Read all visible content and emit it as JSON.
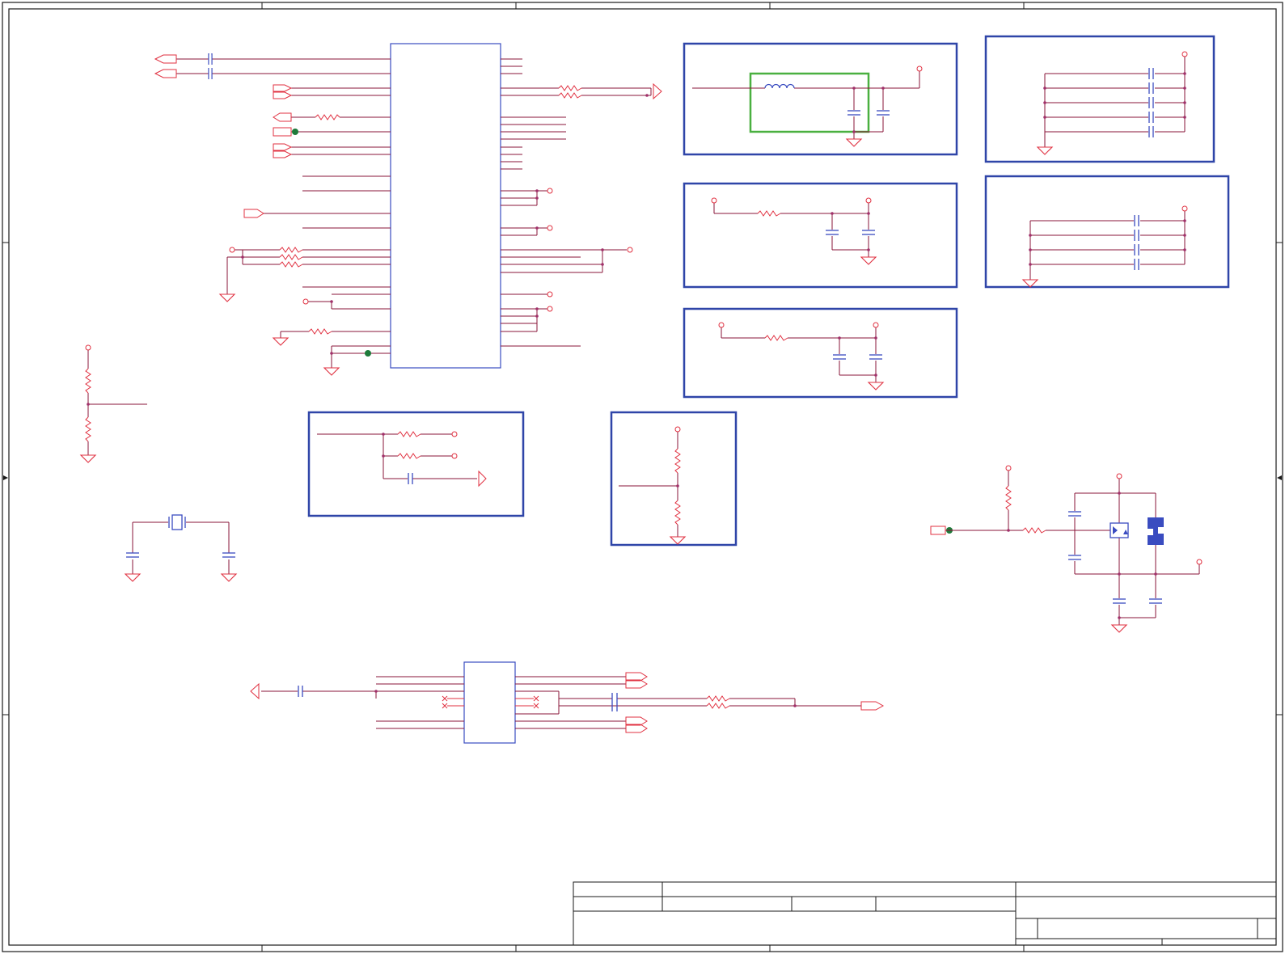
{
  "sheet": {
    "title_block": {
      "title": "",
      "company": "",
      "document_number": "",
      "revision": "",
      "sheet": "",
      "date": ""
    }
  },
  "colors": {
    "wire": "#8a1538",
    "pin": "#e03040",
    "component": "#3a4cc0",
    "border": "#1a1a1a",
    "box": "#2f45a8",
    "highlight": "#4ab040",
    "junction": "#a0306a",
    "testpoint": "#1e7a3a"
  }
}
